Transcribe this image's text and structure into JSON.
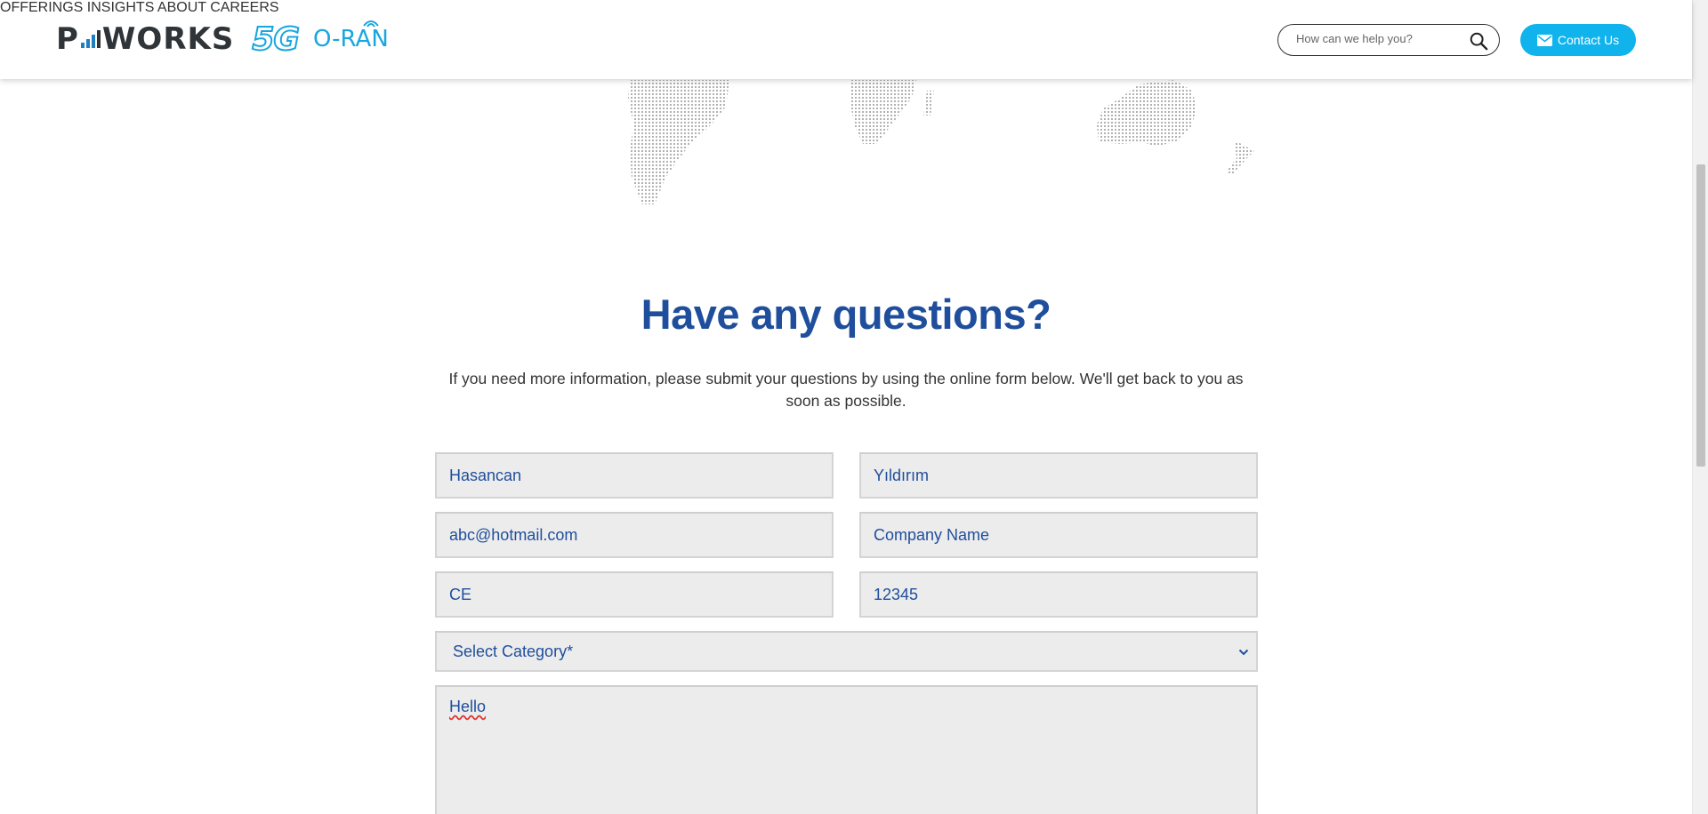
{
  "brand": {
    "logo_text": "P WORKS",
    "logo_5g": "5G",
    "logo_oran": "O-RAN"
  },
  "nav": {
    "items": [
      {
        "label": "OFFERINGS"
      },
      {
        "label": "INSIGHTS"
      },
      {
        "label": "ABOUT"
      },
      {
        "label": "CAREERS"
      }
    ]
  },
  "search": {
    "placeholder": "How can we help you?",
    "icon": "search-icon"
  },
  "contact_button": {
    "label": "Contact Us",
    "icon": "mail-icon"
  },
  "main": {
    "title": "Have any questions?",
    "intro": "If you need more information, please submit your questions by using the online form below. We'll get back to you as soon as possible."
  },
  "form": {
    "first_name": "Hasancan",
    "last_name": "Yıldırım",
    "email": "abc@hotmail.com",
    "company_placeholder": "Company Name",
    "country": "CE",
    "phone": "12345",
    "category": "Select Category*",
    "message": "Hello"
  },
  "colors": {
    "accent": "#10b3ec",
    "title": "#1f4e9c",
    "field_bg": "#ececec"
  }
}
